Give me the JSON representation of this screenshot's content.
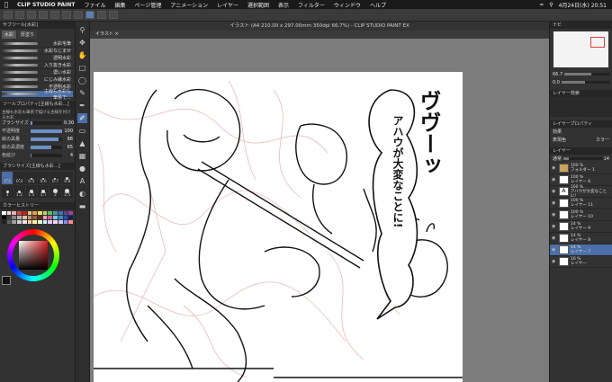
{
  "menubar": {
    "app": "CLIP STUDIO PAINT",
    "items": [
      "ファイル",
      "編集",
      "ページ管理",
      "アニメーション",
      "レイヤー",
      "選択範囲",
      "表示",
      "フィルター",
      "ウィンドウ",
      "ヘルプ"
    ],
    "datetime": "4月24日(水) 20:51"
  },
  "window": {
    "title": "イラスト (A4 210.00 x 297.00mm 350dpi 66.7%) - CLIP STUDIO PAINT EX",
    "tab": "イラスト"
  },
  "subtool": {
    "header": "サブツール[水彩]",
    "tabs": [
      "水彩",
      "厚塗り"
    ],
    "brushes": [
      "水彩毛筆",
      "水彩なじませ",
      "透明水彩",
      "入り抜き水彩",
      "濃い水彩",
      "にじみ縁水彩",
      "不透明水彩",
      "主線も水彩も筆系で…"
    ],
    "selected_index": 7
  },
  "toolprop": {
    "header": "ツールプロパティ[主線も水彩…]",
    "note": "主線も水彩も筆系で描ける主線を付ける水彩",
    "rows": [
      {
        "label": "ブラシサイズ",
        "value": "0.30",
        "fill": 0.05
      },
      {
        "label": "不透明度",
        "value": "100",
        "fill": 1.0
      },
      {
        "label": "絵の具量",
        "value": "88",
        "fill": 0.88
      },
      {
        "label": "絵の具濃度",
        "value": "65",
        "fill": 0.65
      },
      {
        "label": "色延び",
        "value": "4",
        "fill": 0.04
      }
    ]
  },
  "brushsize": {
    "header": "ブラシサイズ[主線も水彩…]",
    "values": [
      "0.3",
      "0.4",
      "0.5",
      "0.6",
      "0.7",
      "0.8",
      "1",
      "1.2",
      "1.5",
      "1.7",
      "2",
      "2.5"
    ],
    "selected_index": 0
  },
  "colorhistory": {
    "header": "カラーヒストリー",
    "colors": [
      "#ffffff",
      "#f3d6d6",
      "#e8b4b4",
      "#d84040",
      "#c02020",
      "#f0c080",
      "#e8a040",
      "#f4e060",
      "#c0d860",
      "#60c060",
      "#40a0a0",
      "#4070c0",
      "#6040a0",
      "#a040a0",
      "#000000",
      "#404040",
      "#808080",
      "#b0b0b0",
      "#e0c0a0",
      "#c09070",
      "#906040",
      "#603020",
      "#f0a0c0",
      "#d06090",
      "#80c0e0",
      "#3090d0",
      "#2050a0",
      "#102060",
      "#202020",
      "#606060",
      "#a0a0a0",
      "#d0d0d0",
      "#ffe0e0",
      "#ffd0a0",
      "#fff0b0",
      "#e0ffd0",
      "#d0f0ff",
      "#e0d0ff",
      "#ffd0f0",
      "#c8c8ff",
      "#8888ff",
      "#ff8888"
    ]
  },
  "tools": [
    "magnifier",
    "move",
    "hand",
    "select",
    "lasso",
    "eyedropper",
    "pen",
    "brush",
    "eraser",
    "fill",
    "gradient",
    "figure",
    "text",
    "balloon",
    "ruler"
  ],
  "right": {
    "nav_zoom": "66.7",
    "nav_angle": "0.0",
    "layer_search_header": "レイヤー検索",
    "layer_prop_header": "レイヤープロパティ",
    "effect_label": "効果",
    "expression_label": "表現色",
    "color_value": "カラー",
    "layer_header": "レイヤー",
    "blend": "通常",
    "opacity": "14",
    "layers": [
      {
        "opacity": "100 %",
        "mode": "通常",
        "name": "フォルダー 1",
        "type": "folder"
      },
      {
        "opacity": "100 %",
        "mode": "通常",
        "name": "レイヤー 6",
        "type": "raster"
      },
      {
        "opacity": "100 %",
        "mode": "通常",
        "name": "アハウが大変なことに!",
        "type": "text"
      },
      {
        "opacity": "100 %",
        "mode": "通常",
        "name": "レイヤー 11",
        "type": "raster"
      },
      {
        "opacity": "100 %",
        "mode": "通常",
        "name": "レイヤー 10",
        "type": "raster"
      },
      {
        "opacity": "14 %",
        "mode": "通常",
        "name": "レイヤー 9",
        "type": "raster"
      },
      {
        "opacity": "14 %",
        "mode": "通常",
        "name": "レイヤー 8",
        "type": "raster"
      },
      {
        "opacity": "14 %",
        "mode": "通常",
        "name": "レイヤー 7",
        "type": "raster",
        "selected": true
      },
      {
        "opacity": "16 %",
        "mode": "通常",
        "name": "レイヤー",
        "type": "raster"
      }
    ]
  },
  "artwork": {
    "sfx": "ヴヴーッ",
    "balloon_text": "アハウが大変なことに!"
  }
}
